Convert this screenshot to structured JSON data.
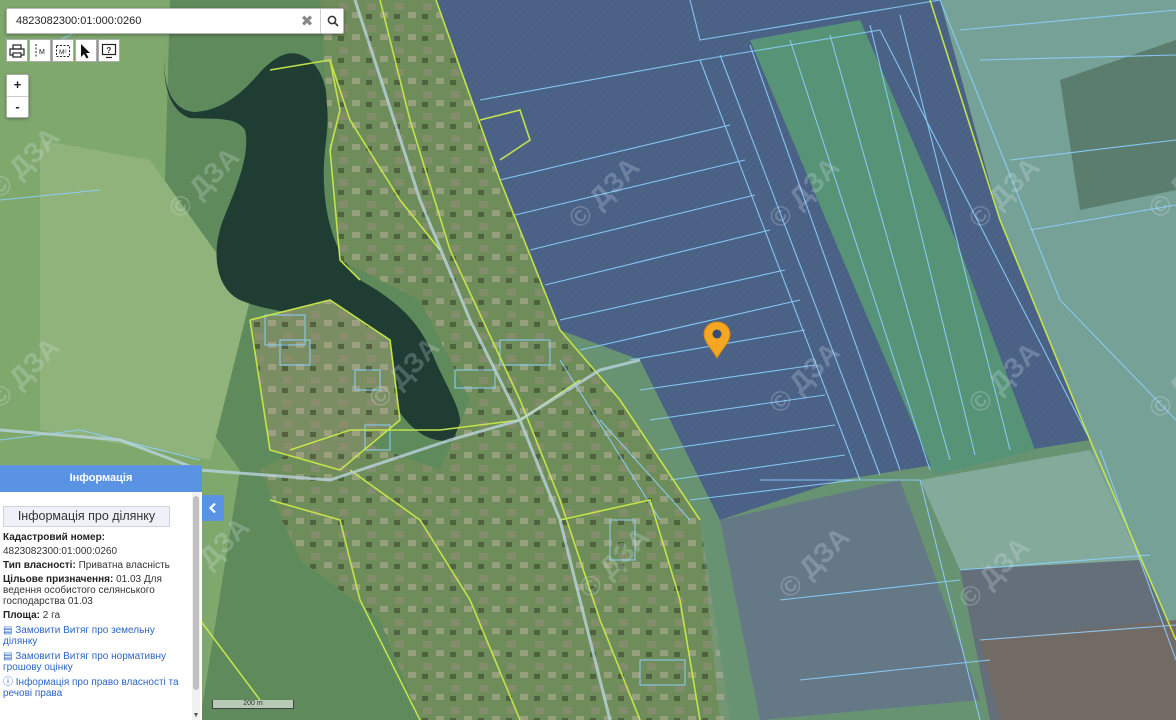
{
  "search": {
    "value": "4823082300:01:000:0260",
    "clear_glyph": "✖"
  },
  "toolbar": [
    {
      "name": "print-icon"
    },
    {
      "name": "measure-length-icon"
    },
    {
      "name": "measure-area-icon"
    },
    {
      "name": "cursor-icon"
    },
    {
      "name": "help-icon"
    }
  ],
  "zoom": {
    "in_label": "+",
    "out_label": "-"
  },
  "map": {
    "watermark": "© ДЗА",
    "marker": "location-pin-icon",
    "marker_color": "#f5a623",
    "parcel_line_color": "#7fc7ff",
    "settlement_line_color": "#c9e84a"
  },
  "info": {
    "header": "Інформація",
    "subtitle": "Інформація про ділянку",
    "cadastral_label": "Кадастровий номер:",
    "cadastral_value": "4823082300:01:000:0260",
    "ownership_label": "Тип власності:",
    "ownership_value": "Приватна власність",
    "purpose_label": "Цільове призначення:",
    "purpose_value": "01.03 Для ведення особистого селянського господарства 01.03",
    "area_label": "Площа:",
    "area_value": "2 га",
    "link1": "Замовити Витяг про земельну ділянку",
    "link2": "Замовити Витяг про нормативну грошову оцінку",
    "link3": "Інформація про право власності та речові права"
  },
  "scale": {
    "label": "200 m"
  }
}
